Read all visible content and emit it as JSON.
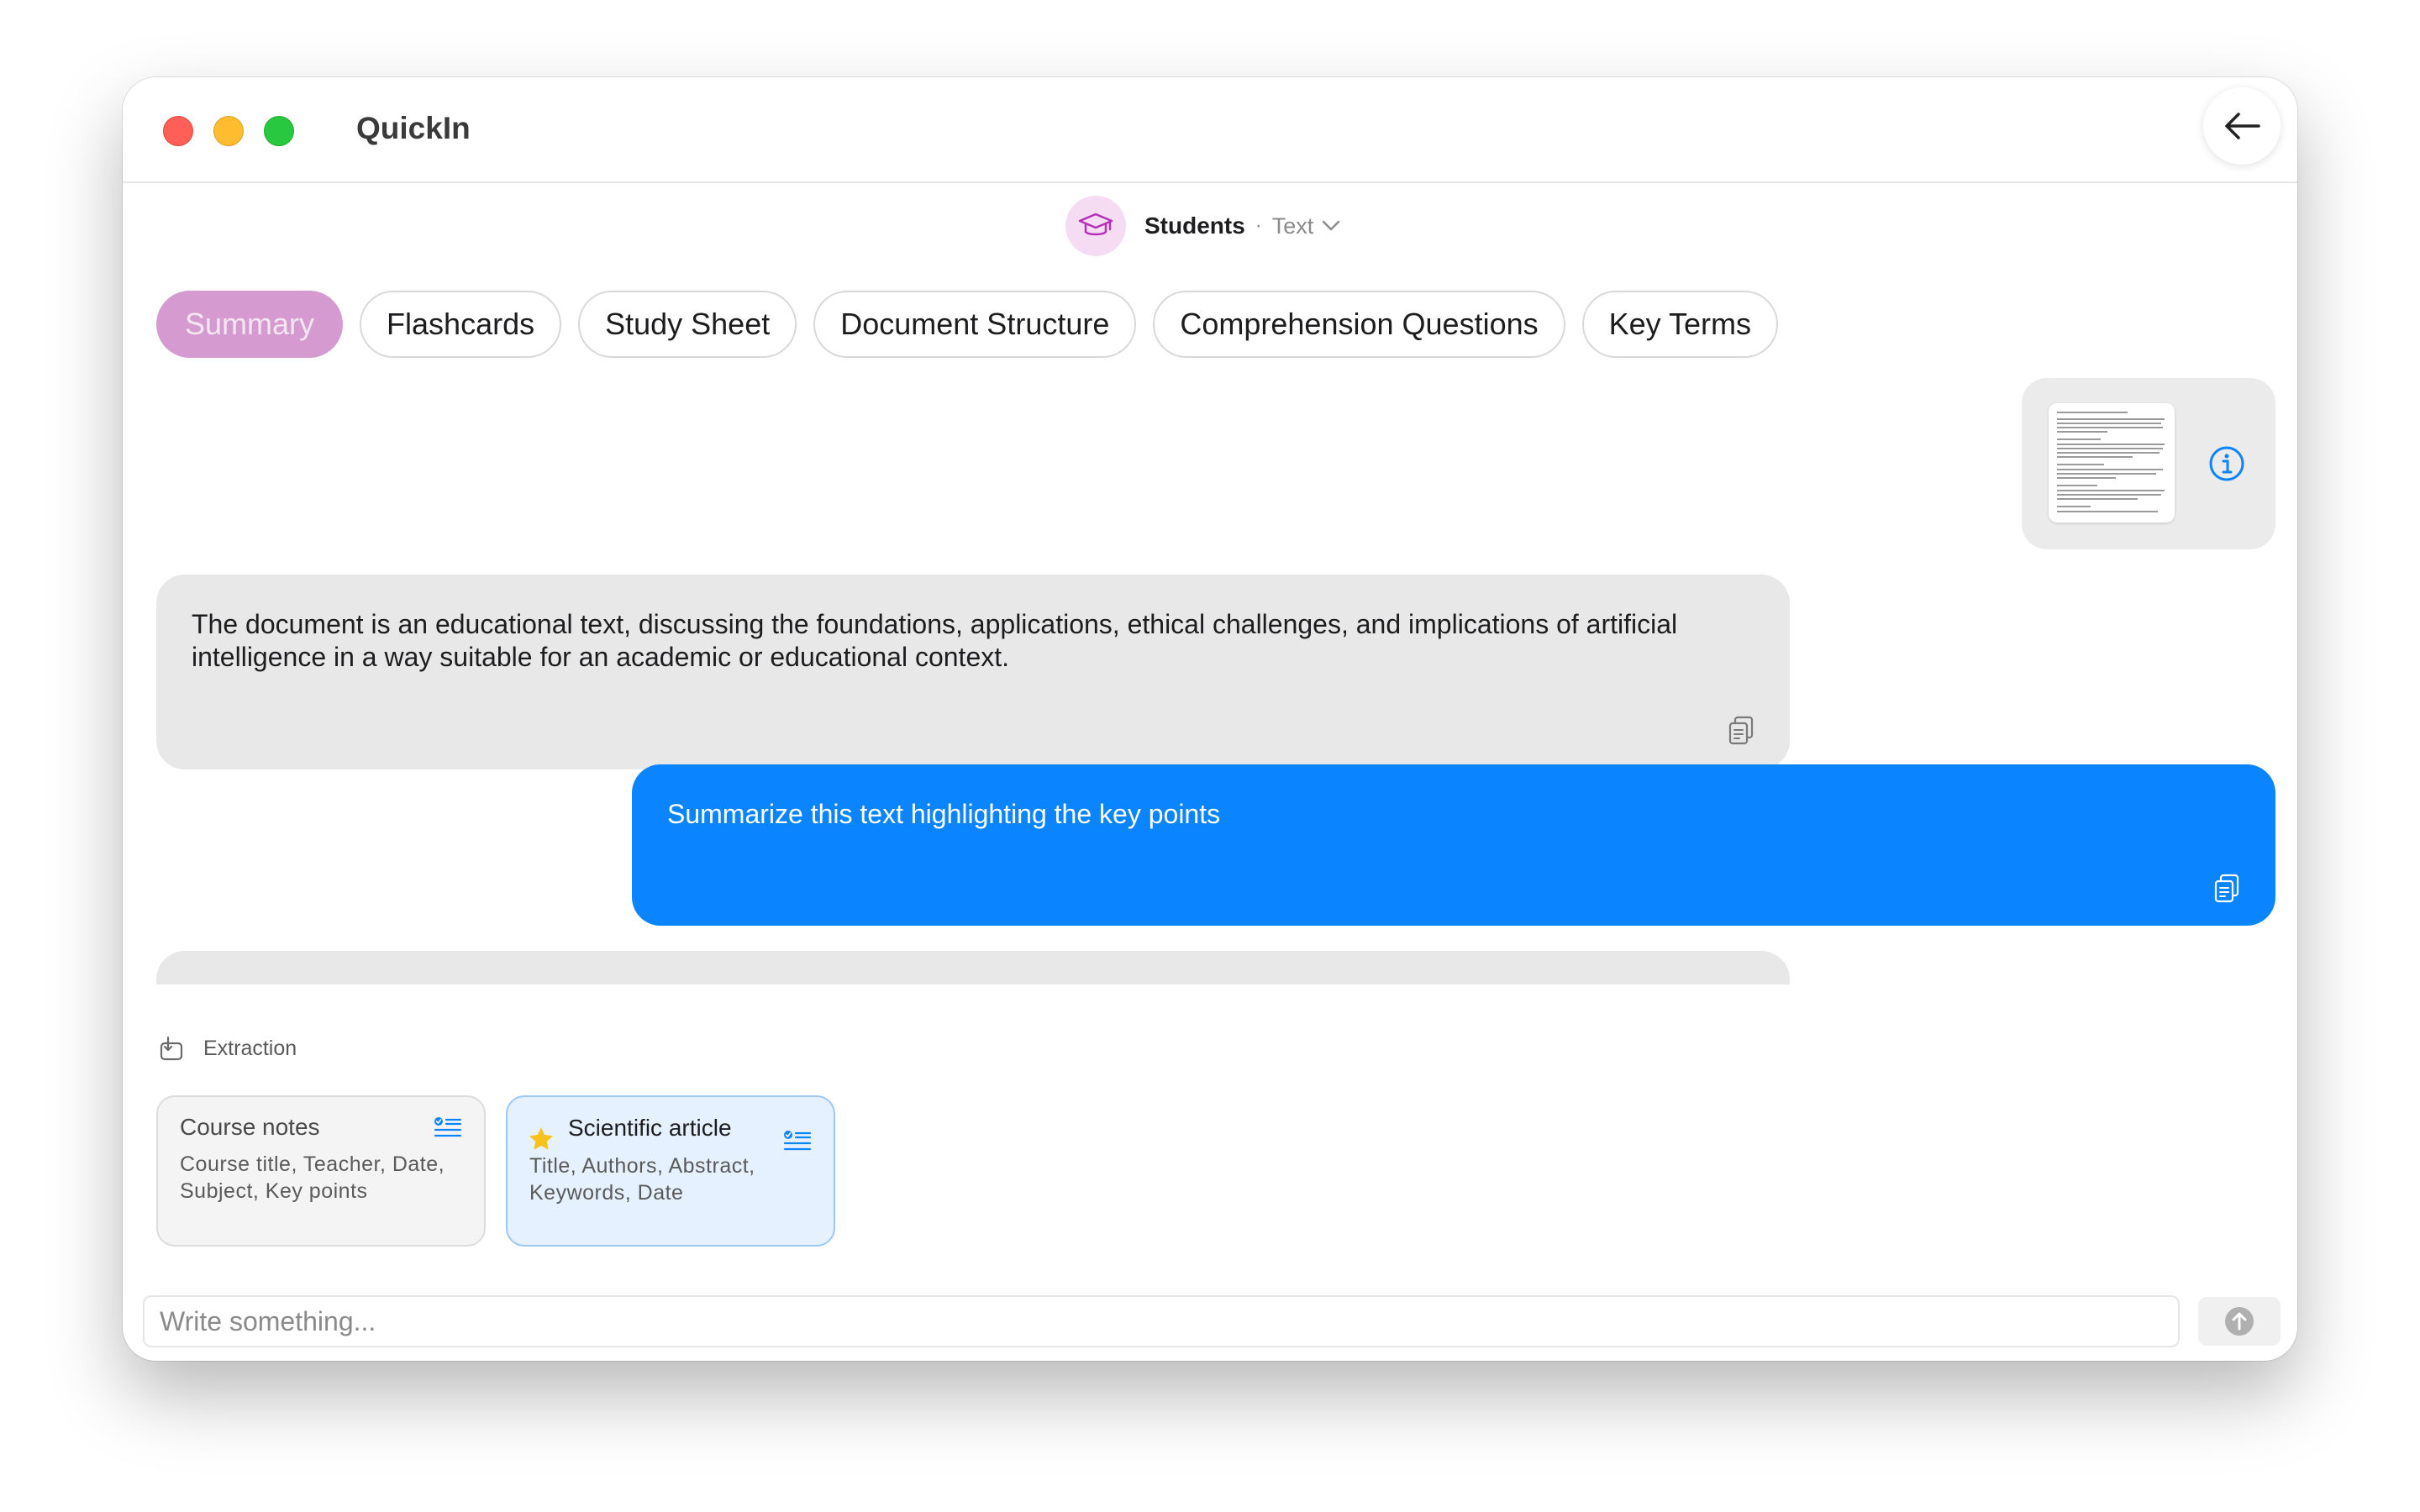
{
  "window": {
    "title": "QuickIn"
  },
  "profile": {
    "name": "Students",
    "separator": "·",
    "mode": "Text",
    "avatar_icon": "graduation-cap-icon"
  },
  "tabs": [
    {
      "label": "Summary",
      "active": true
    },
    {
      "label": "Flashcards",
      "active": false
    },
    {
      "label": "Study Sheet",
      "active": false
    },
    {
      "label": "Document Structure",
      "active": false
    },
    {
      "label": "Comprehension Questions",
      "active": false
    },
    {
      "label": "Key Terms",
      "active": false
    }
  ],
  "messages": [
    {
      "role": "assistant",
      "text": "The document is an educational text, discussing the foundations, applications, ethical challenges, and implications of artificial intelligence in a way suitable for an academic or educational context."
    },
    {
      "role": "user",
      "text": "Summarize this text highlighting the key points"
    }
  ],
  "extraction": {
    "label": "Extraction",
    "templates": [
      {
        "title": "Course notes",
        "fields": "Course title, Teacher, Date, Subject, Key points",
        "starred": false
      },
      {
        "title": "Scientific article",
        "fields": "Title, Authors, Abstract, Keywords, Date",
        "starred": true
      }
    ]
  },
  "composer": {
    "placeholder": "Write something...",
    "value": ""
  },
  "colors": {
    "accent_tab": "#d59bd0",
    "user_bubble": "#0a84ff",
    "assistant_bubble": "#e8e8e8",
    "selected_card": "#e5f1fe",
    "info_icon": "#0a84ff",
    "star": "#f7c21a"
  }
}
